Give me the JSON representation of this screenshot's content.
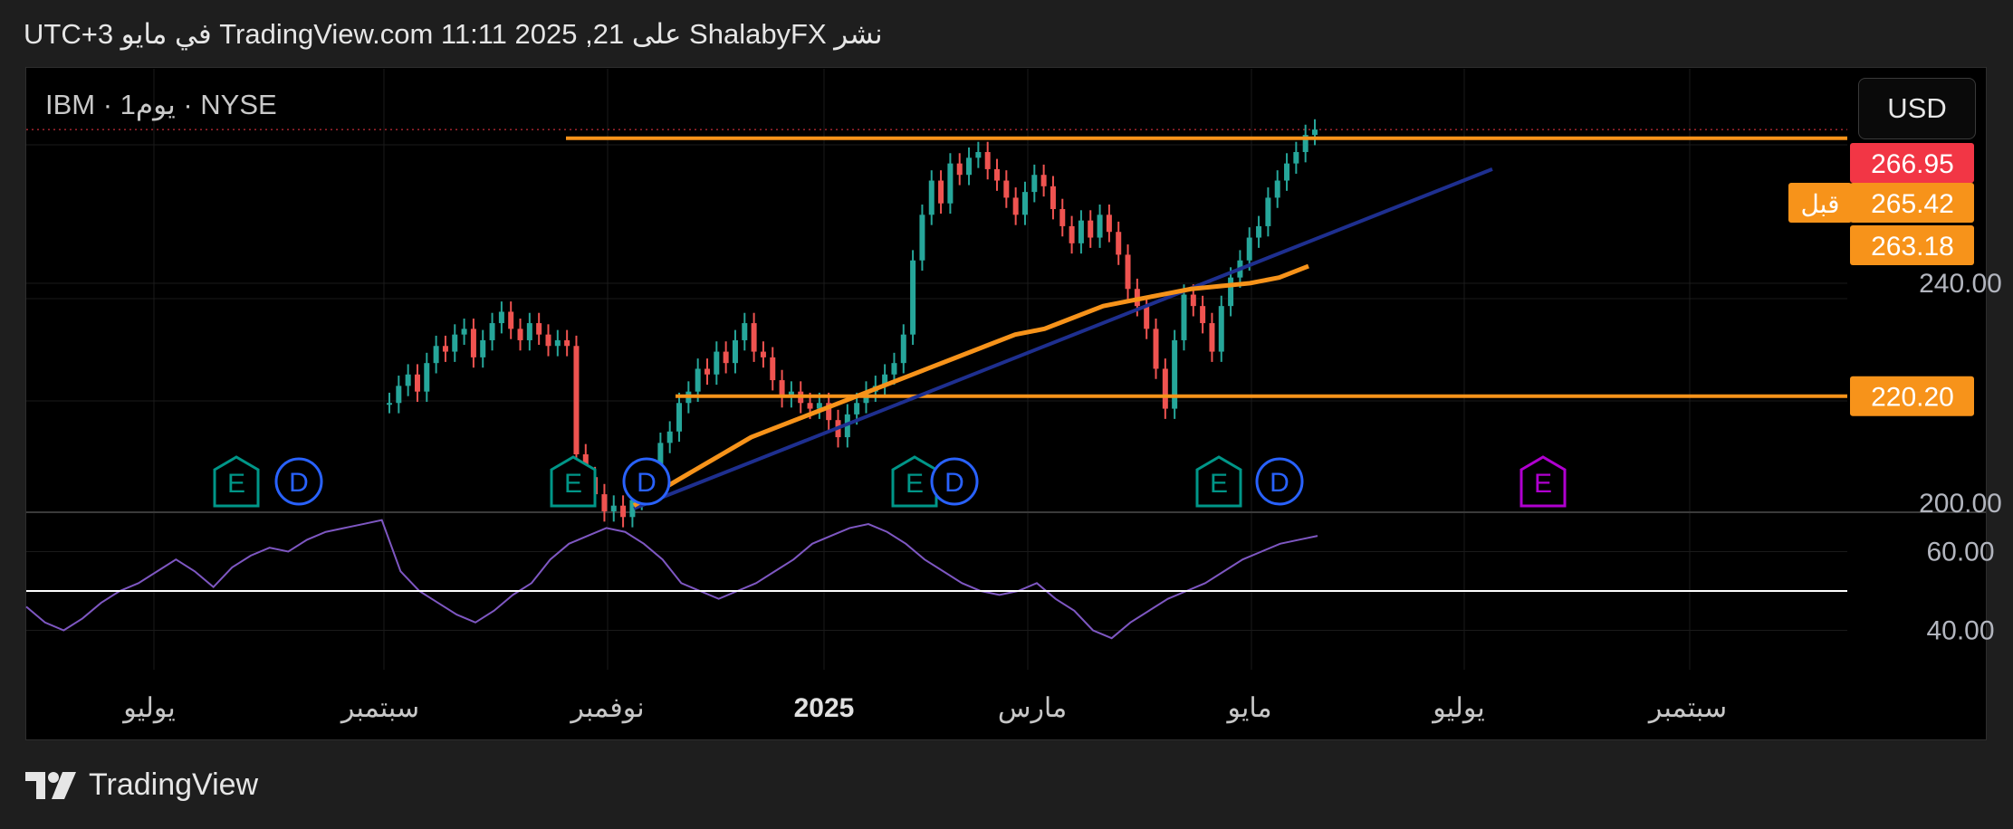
{
  "header": {
    "published_text": "نشر ShalabyFX على TradingView.com 11:11 2025 ,21 في مايو UTC+3"
  },
  "symbol_label": "IBM · 1يوم · NYSE",
  "currency_button": "USD",
  "brand": {
    "name": "TradingView"
  },
  "colors": {
    "background": "#000000",
    "up": "#26a69a",
    "down": "#ef5350",
    "orange": "#f7931a",
    "blue_trend": "#1e2f8f",
    "rsi": "#7e57c2",
    "price_badge_last": "#f23645",
    "event_earnings": "#009688",
    "event_earnings_future": "#b000d0",
    "event_dividend": "#2962ff"
  },
  "chart_data": {
    "type": "candlestick",
    "symbol": "IBM",
    "interval": "1D",
    "exchange": "NYSE",
    "currency": "USD",
    "price_axis": {
      "range": [
        200,
        273
      ],
      "ticks": [
        "240.00",
        "200.00"
      ],
      "badges": [
        {
          "value": "266.95",
          "color": "#f23645",
          "label": ""
        },
        {
          "value": "265.42",
          "color": "#f7931a",
          "label": "قبل"
        },
        {
          "value": "263.18",
          "color": "#f7931a",
          "label": ""
        },
        {
          "value": "220.20",
          "color": "#f7931a",
          "label": ""
        }
      ]
    },
    "time_axis": {
      "labels": [
        "يوليو",
        "سبتمبر",
        "نوفمبر",
        "2025",
        "مارس",
        "مايو",
        "يوليو",
        "سبتمبر"
      ],
      "bold_label": "2025"
    },
    "horizontal_levels": [
      265.42,
      220.2
    ],
    "ohlc_closes": [
      219,
      222,
      224,
      221,
      226,
      229,
      228,
      231,
      232,
      227,
      230,
      233,
      235,
      232,
      230,
      233,
      231,
      229,
      230,
      229,
      210,
      206,
      203,
      200,
      201,
      199,
      202,
      204,
      207,
      212,
      214,
      219,
      221,
      225,
      224,
      228,
      226,
      230,
      233,
      228,
      227,
      223,
      220,
      221,
      219,
      218,
      219,
      216,
      213,
      217,
      219,
      221,
      222,
      224,
      226,
      231,
      244,
      252,
      258,
      254,
      261,
      259,
      262,
      263,
      260,
      258,
      255,
      252,
      256,
      259,
      257,
      253,
      250,
      247,
      251,
      248,
      252,
      249,
      245,
      239,
      236,
      232,
      225,
      218,
      230,
      238,
      236,
      233,
      228,
      236,
      241,
      244,
      248,
      250,
      255,
      258,
      261,
      263,
      266,
      266.95
    ],
    "moving_average": [
      201,
      204,
      207,
      210,
      213,
      215,
      217,
      219,
      221,
      223,
      225,
      227,
      229,
      231,
      232,
      234,
      236,
      237,
      238,
      239,
      239.5,
      240,
      241,
      243
    ],
    "trend_line": {
      "from": [
        200.5,
        200
      ],
      "to": [
        257,
        260
      ]
    },
    "events": [
      {
        "type": "E",
        "past": true
      },
      {
        "type": "D",
        "past": true
      },
      {
        "type": "E",
        "past": true
      },
      {
        "type": "D",
        "past": true
      },
      {
        "type": "E",
        "past": true
      },
      {
        "type": "D",
        "past": true
      },
      {
        "type": "E",
        "past": true
      },
      {
        "type": "D",
        "past": true
      },
      {
        "type": "E",
        "past": false
      }
    ],
    "rsi_panel": {
      "ticks": [
        "60.00",
        "40.00"
      ],
      "reference_level": 50,
      "values": [
        46,
        42,
        40,
        43,
        47,
        50,
        52,
        55,
        58,
        55,
        51,
        56,
        59,
        61,
        60,
        63,
        65,
        66,
        67,
        68,
        55,
        50,
        47,
        44,
        42,
        45,
        49,
        52,
        58,
        62,
        64,
        66,
        65,
        62,
        58,
        52,
        50,
        48,
        50,
        52,
        55,
        58,
        62,
        64,
        66,
        67,
        65,
        62,
        58,
        55,
        52,
        50,
        49,
        50,
        52,
        48,
        45,
        40,
        38,
        42,
        45,
        48,
        50,
        52,
        55,
        58,
        60,
        62,
        63,
        64
      ]
    }
  }
}
